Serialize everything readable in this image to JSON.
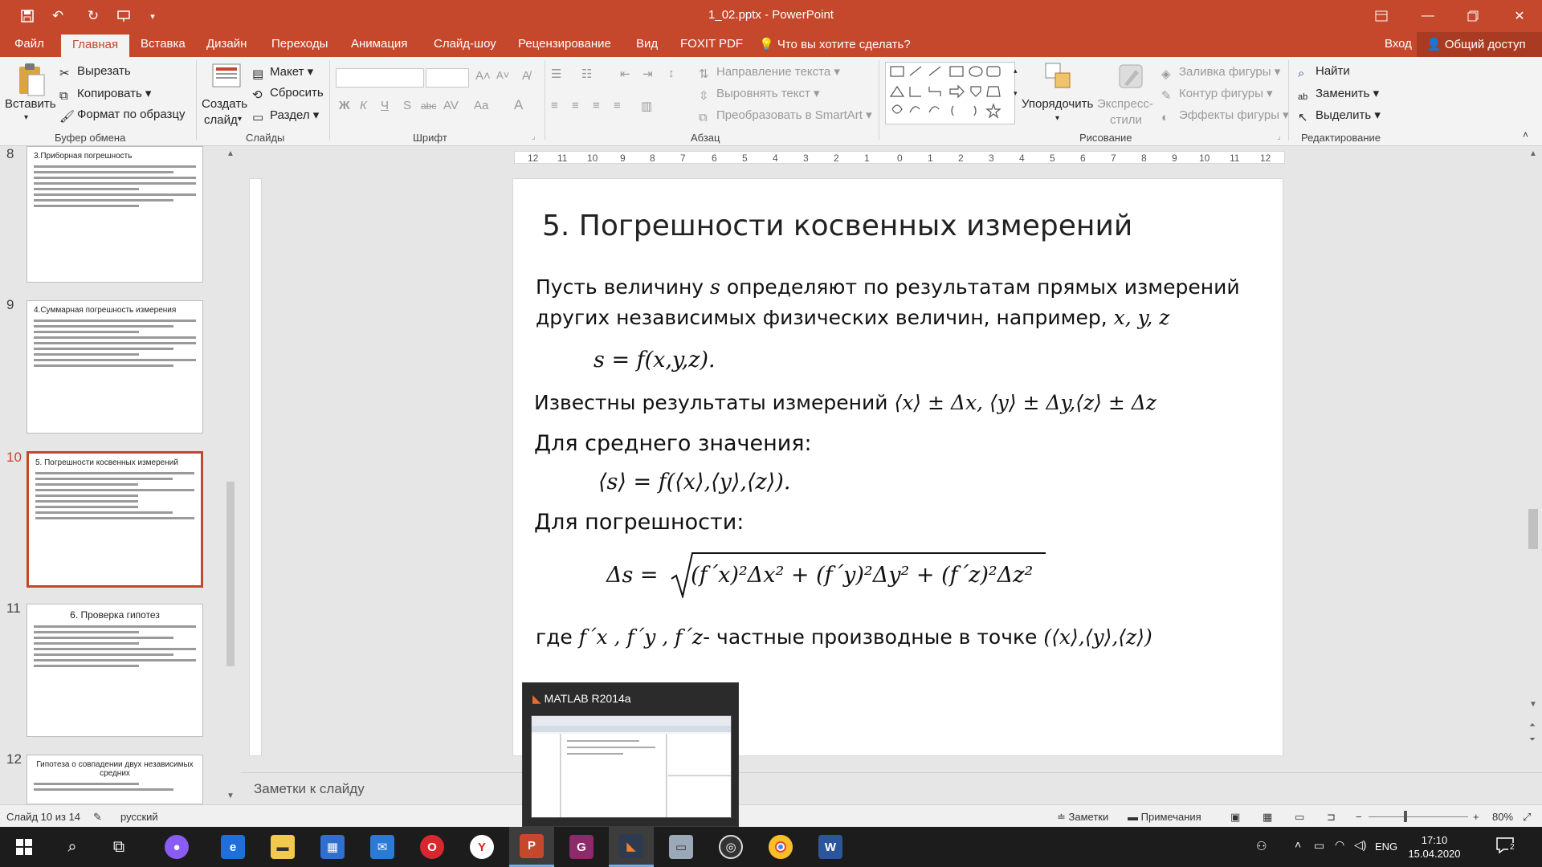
{
  "titlebar": {
    "title": "1_02.pptx - PowerPoint",
    "quick_access": [
      "save-icon",
      "undo-icon",
      "redo-icon",
      "presentation-icon",
      "customize-icon"
    ],
    "window_buttons": [
      "ribbon-display-icon",
      "minimize-icon",
      "restore-icon",
      "close-icon"
    ]
  },
  "tabs": {
    "items": [
      "Файл",
      "Главная",
      "Вставка",
      "Дизайн",
      "Переходы",
      "Анимация",
      "Слайд-шоу",
      "Рецензирование",
      "Вид",
      "FOXIT PDF"
    ],
    "active": "Главная",
    "tell_me": "Что вы хотите сделать?",
    "sign_in": "Вход",
    "share": "Общий доступ"
  },
  "ribbon": {
    "clipboard": {
      "paste": "Вставить",
      "cut": "Вырезать",
      "copy": "Копировать",
      "format_painter": "Формат по образцу",
      "label": "Буфер обмена"
    },
    "slides": {
      "new_slide_1": "Создать",
      "new_slide_2": "слайд",
      "layout": "Макет",
      "reset": "Сбросить",
      "section": "Раздел",
      "label": "Слайды"
    },
    "font": {
      "bold": "Ж",
      "italic": "К",
      "underline": "Ч",
      "shadow": "S",
      "strike": "abc",
      "spacing": "AV",
      "case": "Aa",
      "color": "A",
      "label": "Шрифт"
    },
    "paragraph": {
      "text_direction": "Направление текста",
      "align_text": "Выровнять текст",
      "smartart": "Преобразовать в SmartArt",
      "label": "Абзац"
    },
    "drawing": {
      "arrange": "Упорядочить",
      "quick_styles_1": "Экспресс-",
      "quick_styles_2": "стили",
      "shape_fill": "Заливка фигуры",
      "shape_outline": "Контур фигуры",
      "shape_effects": "Эффекты фигуры",
      "label": "Рисование"
    },
    "editing": {
      "find": "Найти",
      "replace": "Заменить",
      "select": "Выделить",
      "label": "Редактирование"
    }
  },
  "thumbnails": [
    {
      "num": "8",
      "title": "3.Приборная погрешность",
      "selected": false
    },
    {
      "num": "9",
      "title": "4.Суммарная погрешность измерения",
      "selected": false
    },
    {
      "num": "10",
      "title": "5. Погрешности косвенных измерений",
      "selected": true
    },
    {
      "num": "11",
      "title": "6. Проверка гипотез",
      "selected": false
    },
    {
      "num": "12",
      "title": "Гипотеза о совпадении двух независимых средних",
      "selected": false
    }
  ],
  "ruler": {
    "h_ticks": [
      "12",
      "11",
      "10",
      "9",
      "8",
      "7",
      "6",
      "5",
      "4",
      "3",
      "2",
      "1",
      "0",
      "1",
      "2",
      "3",
      "4",
      "5",
      "6",
      "7",
      "8",
      "9",
      "10",
      "11",
      "12"
    ]
  },
  "slide": {
    "title": "5. Погрешности косвенных измерений",
    "p1_line1_a": "Пусть величину ",
    "p1_line1_var": "s",
    "p1_line1_b": " определяют по результатам прямых измерений",
    "p1_line2_a": "других независимых физических величин, например, ",
    "p1_line2_vars": "x, y, z",
    "eq1": "s = f(x,y,z).",
    "known_text": "Известны результаты измерений ",
    "known_math": "⟨x⟩ ± Δx, ⟨y⟩ ± Δy,⟨z⟩ ± Δz",
    "mean_label": "Для среднего значения:",
    "eq2": "⟨s⟩ = f(⟨x⟩,⟨y⟩,⟨z⟩).",
    "err_label": "Для погрешности:",
    "eq3_lhs": "Δs =",
    "eq3_rhs": "(f´x)²Δx² + (f´y)²Δy² + (f´z)²Δz²",
    "where_a": "где ",
    "where_vars": "f´x , f´y , f´z",
    "where_b": "- частные производные в точке ",
    "where_point": "(⟨x⟩,⟨y⟩,⟨z⟩)"
  },
  "notes": {
    "placeholder": "Заметки к слайду"
  },
  "statusbar": {
    "slide_counter": "Слайд 10 из 14",
    "language": "русский",
    "notes_btn": "Заметки",
    "comments_btn": "Примечания",
    "zoom": "80%"
  },
  "taskbar": {
    "preview_title": "MATLAB R2014a",
    "tray_lang": "ENG",
    "time": "17:10",
    "date": "15.04.2020",
    "notifications": "2"
  },
  "colors": {
    "accent": "#c5472c",
    "ribbon": "#f3f3f3",
    "taskbar": "#1c1c1c"
  }
}
